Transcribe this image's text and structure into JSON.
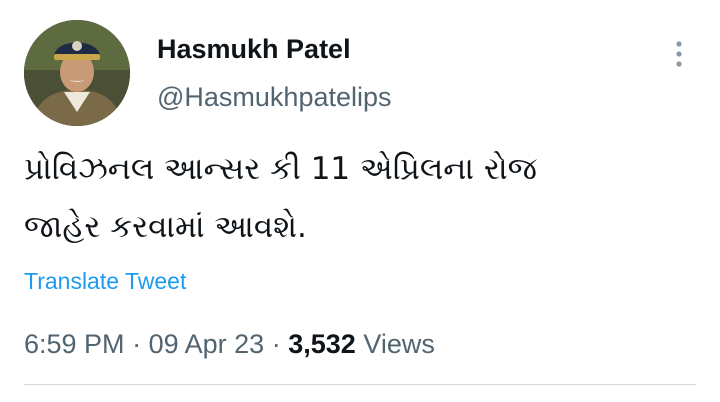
{
  "author": {
    "display_name": "Hasmukh Patel",
    "handle": "@Hasmukhpatelips"
  },
  "tweet": {
    "text_line1": "પ્રોવિઝનલ આન્સર કી 11 એપ્રિલના રોજ",
    "text_line2": "જાહેર કરવામાં આવશે.",
    "translate_label": "Translate Tweet"
  },
  "meta": {
    "time": "6:59 PM",
    "separator": "·",
    "date": "09 Apr 23",
    "views_count": "3,532",
    "views_label": "Views"
  },
  "icons": {
    "more": "more-vertical-icon"
  },
  "colors": {
    "text_primary": "#0f1419",
    "text_secondary": "#536471",
    "link": "#1d9bf0",
    "divider": "#cfd9de"
  }
}
